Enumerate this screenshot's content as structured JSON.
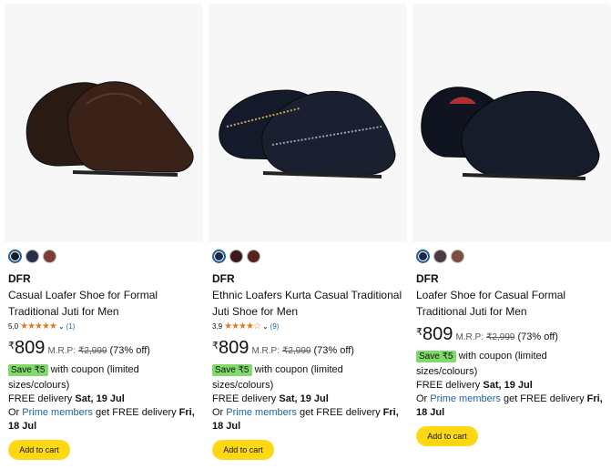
{
  "products": [
    {
      "swatch_colors": [
        "#1a1a1a",
        "#283048",
        "#7a3e32"
      ],
      "brand": "DFR",
      "title": "Casual Loafer Shoe for Formal Traditional Juti for Men",
      "rating_value": "5.0",
      "stars": "★★★★★",
      "chevron": "⌄",
      "review_count": "(1)",
      "currency": "₹",
      "price": "809",
      "mrp_label": "M.R.P:",
      "mrp": "₹2,999",
      "discount": "(73% off)",
      "coupon_badge": "Save ₹5",
      "coupon_text": "with coupon (limited sizes/colours)",
      "delivery_prefix": "FREE delivery ",
      "delivery_date": "Sat, 19 Jul",
      "prime_prefix": "Or ",
      "prime_link": "Prime members",
      "prime_suffix": " get FREE delivery ",
      "prime_date": "Fri, 18 Jul",
      "add_to_cart": "Add to cart"
    },
    {
      "swatch_colors": [
        "#1f2740",
        "#3a1a1a",
        "#5a2020"
      ],
      "brand": "DFR",
      "title": "Ethnic Loafers Kurta Casual Traditional Juti Shoe for Men",
      "rating_value": "3.9",
      "stars": "★★★★☆",
      "chevron": "⌄",
      "review_count": "(9)",
      "currency": "₹",
      "price": "809",
      "mrp_label": "M.R.P:",
      "mrp": "₹2,999",
      "discount": "(73% off)",
      "coupon_badge": "Save ₹5",
      "coupon_text": "with coupon (limited sizes/colours)",
      "delivery_prefix": "FREE delivery ",
      "delivery_date": "Sat, 19 Jul",
      "prime_prefix": "Or ",
      "prime_link": "Prime members",
      "prime_suffix": " get FREE delivery ",
      "prime_date": "Fri, 18 Jul",
      "add_to_cart": "Add to cart"
    },
    {
      "swatch_colors": [
        "#1f2740",
        "#4a3a44",
        "#7a4e40"
      ],
      "brand": "DFR",
      "title": "Loafer Shoe for Casual Formal Traditional Juti for Men",
      "currency": "₹",
      "price": "809",
      "mrp_label": "M.R.P:",
      "mrp": "₹2,999",
      "discount": "(73% off)",
      "coupon_badge": "Save ₹5",
      "coupon_text": "with coupon (limited sizes/colours)",
      "delivery_prefix": "FREE delivery ",
      "delivery_date": "Sat, 19 Jul",
      "prime_prefix": "Or ",
      "prime_link": "Prime members",
      "prime_suffix": " get FREE delivery ",
      "prime_date": "Fri, 18 Jul",
      "add_to_cart": "Add to cart"
    }
  ]
}
